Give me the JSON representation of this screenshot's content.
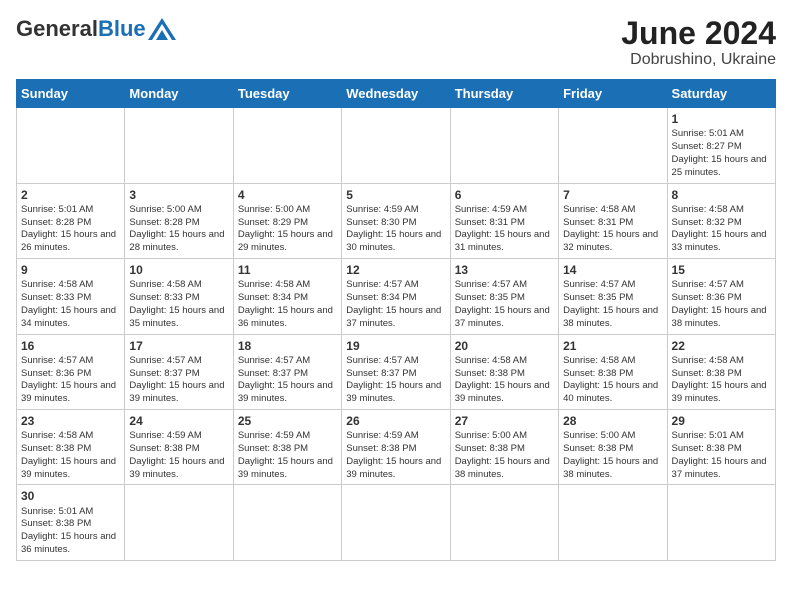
{
  "header": {
    "logo_general": "General",
    "logo_blue": "Blue",
    "title": "June 2024",
    "subtitle": "Dobrushino, Ukraine"
  },
  "days_of_week": [
    "Sunday",
    "Monday",
    "Tuesday",
    "Wednesday",
    "Thursday",
    "Friday",
    "Saturday"
  ],
  "weeks": [
    [
      {
        "day": "",
        "info": ""
      },
      {
        "day": "",
        "info": ""
      },
      {
        "day": "",
        "info": ""
      },
      {
        "day": "",
        "info": ""
      },
      {
        "day": "",
        "info": ""
      },
      {
        "day": "",
        "info": ""
      },
      {
        "day": "1",
        "info": "Sunrise: 5:01 AM\nSunset: 8:27 PM\nDaylight: 15 hours and 25 minutes."
      }
    ],
    [
      {
        "day": "2",
        "info": "Sunrise: 5:01 AM\nSunset: 8:28 PM\nDaylight: 15 hours and 26 minutes."
      },
      {
        "day": "3",
        "info": "Sunrise: 5:00 AM\nSunset: 8:28 PM\nDaylight: 15 hours and 28 minutes."
      },
      {
        "day": "4",
        "info": "Sunrise: 5:00 AM\nSunset: 8:29 PM\nDaylight: 15 hours and 29 minutes."
      },
      {
        "day": "5",
        "info": "Sunrise: 4:59 AM\nSunset: 8:30 PM\nDaylight: 15 hours and 30 minutes."
      },
      {
        "day": "6",
        "info": "Sunrise: 4:59 AM\nSunset: 8:31 PM\nDaylight: 15 hours and 31 minutes."
      },
      {
        "day": "7",
        "info": "Sunrise: 4:58 AM\nSunset: 8:31 PM\nDaylight: 15 hours and 32 minutes."
      },
      {
        "day": "8",
        "info": "Sunrise: 4:58 AM\nSunset: 8:32 PM\nDaylight: 15 hours and 33 minutes."
      }
    ],
    [
      {
        "day": "9",
        "info": "Sunrise: 4:58 AM\nSunset: 8:33 PM\nDaylight: 15 hours and 34 minutes."
      },
      {
        "day": "10",
        "info": "Sunrise: 4:58 AM\nSunset: 8:33 PM\nDaylight: 15 hours and 35 minutes."
      },
      {
        "day": "11",
        "info": "Sunrise: 4:58 AM\nSunset: 8:34 PM\nDaylight: 15 hours and 36 minutes."
      },
      {
        "day": "12",
        "info": "Sunrise: 4:57 AM\nSunset: 8:34 PM\nDaylight: 15 hours and 37 minutes."
      },
      {
        "day": "13",
        "info": "Sunrise: 4:57 AM\nSunset: 8:35 PM\nDaylight: 15 hours and 37 minutes."
      },
      {
        "day": "14",
        "info": "Sunrise: 4:57 AM\nSunset: 8:35 PM\nDaylight: 15 hours and 38 minutes."
      },
      {
        "day": "15",
        "info": "Sunrise: 4:57 AM\nSunset: 8:36 PM\nDaylight: 15 hours and 38 minutes."
      }
    ],
    [
      {
        "day": "16",
        "info": "Sunrise: 4:57 AM\nSunset: 8:36 PM\nDaylight: 15 hours and 39 minutes."
      },
      {
        "day": "17",
        "info": "Sunrise: 4:57 AM\nSunset: 8:37 PM\nDaylight: 15 hours and 39 minutes."
      },
      {
        "day": "18",
        "info": "Sunrise: 4:57 AM\nSunset: 8:37 PM\nDaylight: 15 hours and 39 minutes."
      },
      {
        "day": "19",
        "info": "Sunrise: 4:57 AM\nSunset: 8:37 PM\nDaylight: 15 hours and 39 minutes."
      },
      {
        "day": "20",
        "info": "Sunrise: 4:58 AM\nSunset: 8:38 PM\nDaylight: 15 hours and 39 minutes."
      },
      {
        "day": "21",
        "info": "Sunrise: 4:58 AM\nSunset: 8:38 PM\nDaylight: 15 hours and 40 minutes."
      },
      {
        "day": "22",
        "info": "Sunrise: 4:58 AM\nSunset: 8:38 PM\nDaylight: 15 hours and 39 minutes."
      }
    ],
    [
      {
        "day": "23",
        "info": "Sunrise: 4:58 AM\nSunset: 8:38 PM\nDaylight: 15 hours and 39 minutes."
      },
      {
        "day": "24",
        "info": "Sunrise: 4:59 AM\nSunset: 8:38 PM\nDaylight: 15 hours and 39 minutes."
      },
      {
        "day": "25",
        "info": "Sunrise: 4:59 AM\nSunset: 8:38 PM\nDaylight: 15 hours and 39 minutes."
      },
      {
        "day": "26",
        "info": "Sunrise: 4:59 AM\nSunset: 8:38 PM\nDaylight: 15 hours and 39 minutes."
      },
      {
        "day": "27",
        "info": "Sunrise: 5:00 AM\nSunset: 8:38 PM\nDaylight: 15 hours and 38 minutes."
      },
      {
        "day": "28",
        "info": "Sunrise: 5:00 AM\nSunset: 8:38 PM\nDaylight: 15 hours and 38 minutes."
      },
      {
        "day": "29",
        "info": "Sunrise: 5:01 AM\nSunset: 8:38 PM\nDaylight: 15 hours and 37 minutes."
      }
    ],
    [
      {
        "day": "30",
        "info": "Sunrise: 5:01 AM\nSunset: 8:38 PM\nDaylight: 15 hours and 36 minutes."
      },
      {
        "day": "",
        "info": ""
      },
      {
        "day": "",
        "info": ""
      },
      {
        "day": "",
        "info": ""
      },
      {
        "day": "",
        "info": ""
      },
      {
        "day": "",
        "info": ""
      },
      {
        "day": "",
        "info": ""
      }
    ]
  ]
}
